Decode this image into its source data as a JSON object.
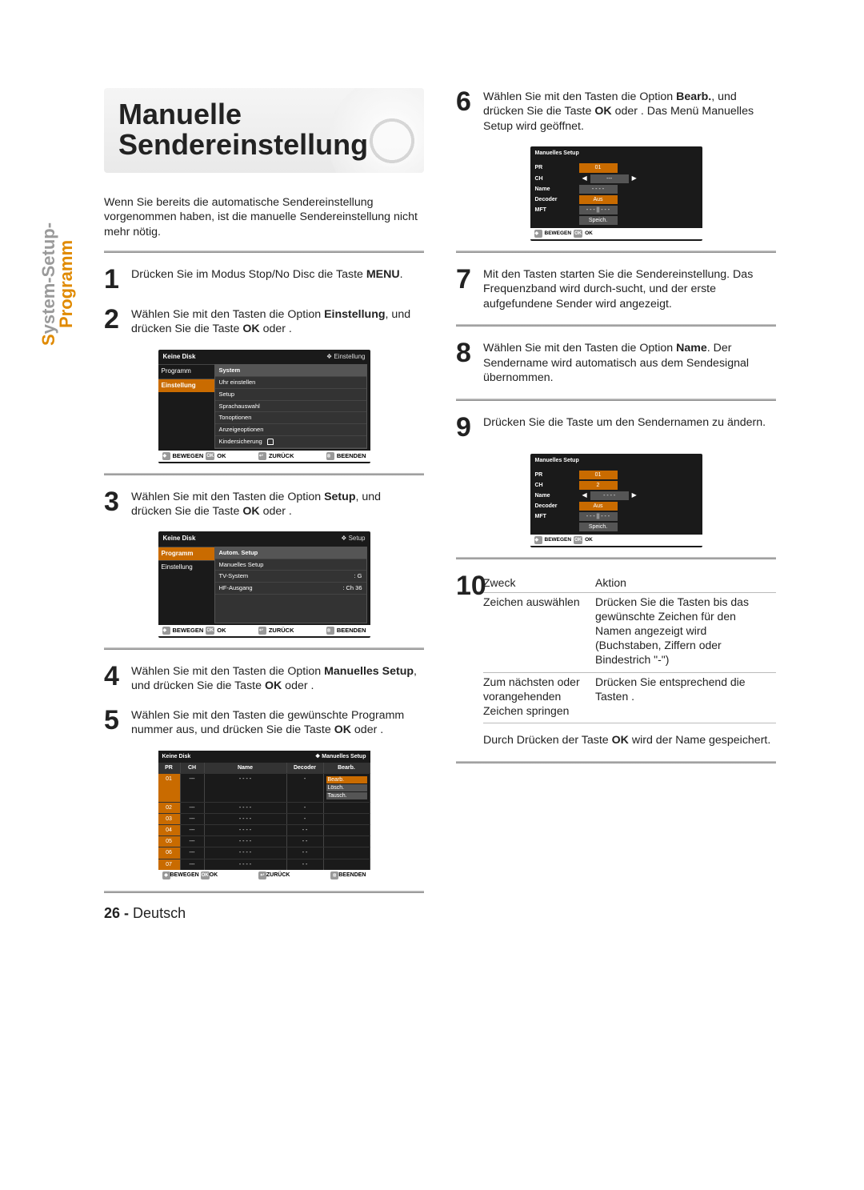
{
  "sideTab": {
    "line1_gray": "ystem-Setup-",
    "line1_first": "S",
    "line2": "Programm"
  },
  "title": "Manuelle Sendereinstellung",
  "intro": "Wenn Sie bereits die automatische Sendereinstellung vorgenommen haben, ist die manuelle Sendereinstellung nicht mehr nötig.",
  "steps": {
    "s1": {
      "n": "1",
      "t_a": "Drücken Sie im Modus Stop/No Disc die Taste ",
      "t_b": "MENU",
      "t_c": "."
    },
    "s2": {
      "n": "2",
      "t_a": "Wählen Sie mit den Tasten ",
      "t_b": " die Option ",
      "t_c": "Einstellung",
      "t_d": ", und drücken Sie die Taste ",
      "t_e": "OK",
      "t_f": " oder    ."
    },
    "s3": {
      "n": "3",
      "t_a": "Wählen Sie mit den Tasten ",
      "t_b": " die Option ",
      "t_c": "Setup",
      "t_d": ", und drücken Sie die Taste ",
      "t_e": "OK",
      "t_f": " oder    ."
    },
    "s4": {
      "n": "4",
      "t_a": "Wählen Sie mit den Tasten ",
      "t_b": " die Option ",
      "t_c": "Manuelles Setup",
      "t_d": ", und drücken Sie die Taste ",
      "t_e": "OK",
      "t_f": " oder    ."
    },
    "s5": {
      "n": "5",
      "t_a": "Wählen Sie mit den Tasten ",
      "t_b": " die gewünschte Programm nummer aus, und drücken Sie die Taste ",
      "t_c": "OK",
      "t_d": " oder    ."
    },
    "s6": {
      "n": "6",
      "t_a": "Wählen Sie mit den Tasten ",
      "t_b": " die Option ",
      "t_c": "Bearb.",
      "t_d": ", und drücken Sie die Taste ",
      "t_e": "OK",
      "t_f": " oder    . Das Menü Manuelles Setup wird geöffnet."
    },
    "s7": {
      "n": "7",
      "t_a": "Mit den Tasten ",
      "t_b": " starten Sie die Sendereinstellung. Das Frequenzband wird durch-sucht, und der erste aufgefundene Sender wird angezeigt."
    },
    "s8": {
      "n": "8",
      "t_a": "Wählen Sie mit den Tasten ",
      "t_b": " die Option ",
      "t_c": "Name",
      "t_d": ". Der Sendername wird automatisch aus dem Sendesignal übernommen."
    },
    "s9": {
      "n": "9",
      "t_a": "Drücken Sie die Taste ",
      "t_b": " um den Sendernamen zu ändern."
    },
    "s10": {
      "n": "10"
    }
  },
  "table10": {
    "h1": "Zweck",
    "h2": "Aktion",
    "r1a": "Zeichen auswählen",
    "r1b": "Drücken Sie die Tasten         bis das gewünschte Zeichen für den Namen angezeigt wird (Buchstaben, Ziffern oder Bindestrich \"-\")",
    "r2a": "Zum nächsten oder vorangehenden Zeichen springen",
    "r2b": "Drücken Sie entsprechend die Tasten        ."
  },
  "afterTable": "Durch Drücken der Taste OK wird der Name gespeichert.",
  "afterTable_pre": "Durch Drücken der Taste ",
  "afterTable_ok": "OK",
  "afterTable_post": " wird der Name gespeichert.",
  "osd1": {
    "hdr_l": "Keine Disk",
    "hdr_r": "❖  Einstellung",
    "ml": [
      "Programm",
      "Einstellung"
    ],
    "mr": [
      "System",
      "Uhr einstellen",
      "Setup",
      "Sprachauswahl",
      "Tonoptionen",
      "Anzeigeoptionen",
      "Kindersicherung"
    ],
    "f1": "BEWEGEN",
    "f1b": "OK",
    "f2": "ZURÜCK",
    "f3": "BEENDEN"
  },
  "osd2": {
    "hdr_l": "Keine Disk",
    "hdr_r": "❖  Setup",
    "ml": [
      "Programm",
      "Einstellung"
    ],
    "mr": [
      {
        "l": "Autom. Setup",
        "r": ""
      },
      {
        "l": "Manuelles Setup",
        "r": ""
      },
      {
        "l": "TV-System",
        "r": ": G"
      },
      {
        "l": "HF-Ausgang",
        "r": ": Ch 36"
      }
    ],
    "f1": "BEWEGEN",
    "f1b": "OK",
    "f2": "ZURÜCK",
    "f3": "BEENDEN"
  },
  "osd3": {
    "hdr_l": "Keine Disk",
    "hdr_r": "❖  Manuelles Setup",
    "th": [
      "PR",
      "CH",
      "Name",
      "Decoder",
      "Bearb."
    ],
    "rows": [
      {
        "pr": "01",
        "ch": "---",
        "name": "- - - -",
        "dec": "-",
        "opts": [
          "Bearb.",
          "Lösch.",
          "Tausch."
        ]
      },
      {
        "pr": "02",
        "ch": "---",
        "name": "- - - -",
        "dec": "-"
      },
      {
        "pr": "03",
        "ch": "---",
        "name": "- - - -",
        "dec": "-"
      },
      {
        "pr": "04",
        "ch": "---",
        "name": "- - - -",
        "dec": "- -"
      },
      {
        "pr": "05",
        "ch": "---",
        "name": "- - - -",
        "dec": "- -"
      },
      {
        "pr": "06",
        "ch": "---",
        "name": "- - - -",
        "dec": "- -"
      },
      {
        "pr": "07",
        "ch": "---",
        "name": "- - - -",
        "dec": "- -"
      }
    ],
    "f1": "BEWEGEN",
    "f1b": "OK",
    "f2": "ZURÜCK",
    "f3": "BEENDEN"
  },
  "osd4": {
    "title": "Manuelles Setup",
    "rows": [
      {
        "k": "PR",
        "v": "01",
        "hl": true
      },
      {
        "k": "CH",
        "v": "---",
        "arrows": true
      },
      {
        "k": "Name",
        "v": "- - - -"
      },
      {
        "k": "Decoder",
        "v": "Aus",
        "hl": true
      },
      {
        "k": "MFT",
        "v": "- - - || - - -"
      }
    ],
    "save": "Speich.",
    "f1": "BEWEGEN",
    "f1b": "OK"
  },
  "osd5": {
    "title": "Manuelles Setup",
    "rows": [
      {
        "k": "PR",
        "v": "01",
        "hl": true
      },
      {
        "k": "CH",
        "v": "2",
        "hl": true
      },
      {
        "k": "Name",
        "v": "- - - -",
        "arrows": true
      },
      {
        "k": "Decoder",
        "v": "Aus",
        "hl": true
      },
      {
        "k": "MFT",
        "v": "- - - || - - -"
      }
    ],
    "save": "Speich.",
    "f1": "BEWEGEN",
    "f1b": "OK"
  },
  "footer": {
    "num": "26 -",
    "lang": "Deutsch"
  }
}
